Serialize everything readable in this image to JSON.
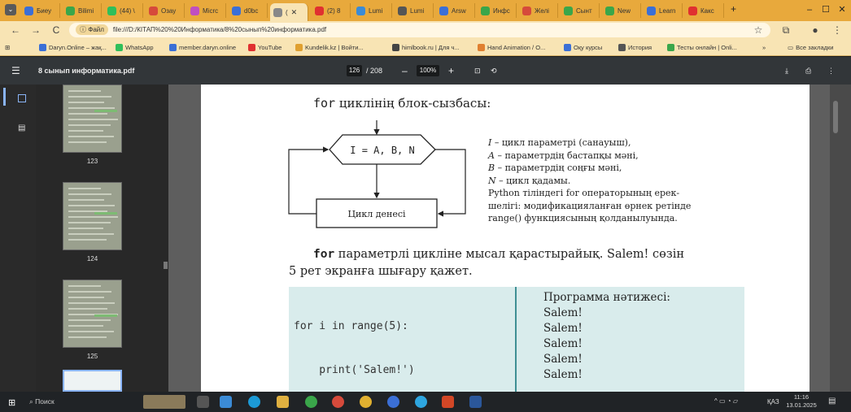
{
  "tabs": [
    {
      "label": "Биеу",
      "color": "#3b6fd6"
    },
    {
      "label": "Bilimi",
      "color": "#3aa64a"
    },
    {
      "label": "(44) \\",
      "color": "#2fbf5a"
    },
    {
      "label": "Озау",
      "color": "#d64a3b"
    },
    {
      "label": "Micrc",
      "color": "#c04fc0"
    },
    {
      "label": "d0bc",
      "color": "#3b6fd6"
    },
    {
      "label": "(",
      "color": "#888"
    },
    {
      "label": "(2) 8",
      "color": "#e03030"
    },
    {
      "label": "Lumi",
      "color": "#3b8bd6"
    },
    {
      "label": "Lumi",
      "color": "#555"
    },
    {
      "label": "Arsw",
      "color": "#3b6fd6"
    },
    {
      "label": "Инфс",
      "color": "#3aa64a"
    },
    {
      "label": "Желі",
      "color": "#d64a3b"
    },
    {
      "label": "Сынт",
      "color": "#3aa64a"
    },
    {
      "label": "New",
      "color": "#3aa64a"
    },
    {
      "label": "Learn",
      "color": "#3b6fd6"
    },
    {
      "label": "Какс",
      "color": "#e03030"
    }
  ],
  "address": {
    "chip": "Файл",
    "url": "file:///D:/КІТАП%20%20Информатика/8%20сынып%20информатика.pdf"
  },
  "bookmarks": [
    {
      "label": "Daryn.Online – жақ...",
      "color": "#3b6fd6"
    },
    {
      "label": "WhatsApp",
      "color": "#2fbf5a"
    },
    {
      "label": "member.daryn.online",
      "color": "#3b6fd6"
    },
    {
      "label": "YouTube",
      "color": "#e03030"
    },
    {
      "label": "Kundelik.kz | Войти...",
      "color": "#e0a030"
    },
    {
      "label": "himlbook.ru | Для ч...",
      "color": "#444"
    },
    {
      "label": "Hand Animation / O...",
      "color": "#e08030"
    },
    {
      "label": "Оқу курсы",
      "color": "#3b6fd6"
    },
    {
      "label": "История",
      "color": "#555"
    },
    {
      "label": "Тесты онлайн | Onli...",
      "color": "#3aa64a"
    }
  ],
  "bookmarks_more": "»",
  "bookmarks_all": "Все закладки",
  "pdf": {
    "title": "8 сынып информатика.pdf",
    "page": "126",
    "total": "/ 208",
    "zoom": "100%"
  },
  "thumbs": [
    {
      "num": "123"
    },
    {
      "num": "124"
    },
    {
      "num": "125"
    }
  ],
  "content": {
    "heading_kw": "for",
    "heading_rest": " циклінің блок-сызбасы:",
    "hex_label": "I = A, B, N",
    "body_label": "Цикл денесі",
    "legend": [
      {
        "sym": "I",
        "text": " – цикл параметрі (санауыш),"
      },
      {
        "sym": "A",
        "text": " – параметрдің бастапқы мәні,"
      },
      {
        "sym": "B",
        "text": " – параметрдің соңғы мәні,"
      },
      {
        "sym": "N",
        "text": " – цикл қадамы."
      }
    ],
    "py_note": [
      "Python тіліндегі for операторының ерек-",
      "шелігі: модификацияланған өрнек ретінде",
      "range() функциясының қолданылуында."
    ],
    "para_kw": "for",
    "para_line1": " параметрлі цикліне мысал қарастырайық. Salem! сөзін",
    "para_line2": "5 рет экранға шығару қажет.",
    "code": [
      "for i in range(5):",
      "    print('Salem!')"
    ],
    "result_title": "Программа нәтижесі:",
    "results": [
      "Salem!",
      "Salem!",
      "Salem!",
      "Salem!",
      "Salem!"
    ]
  },
  "taskbar": {
    "search": "Поиск",
    "lang": "ҚАЗ",
    "time": "11:16",
    "date": "13.01.2025"
  }
}
